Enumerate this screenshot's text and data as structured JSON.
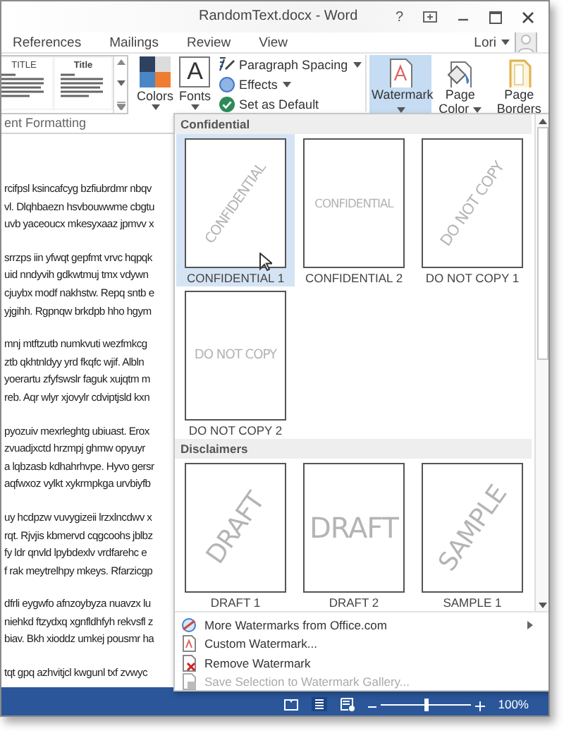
{
  "window": {
    "title": "RandomText.docx - Word",
    "help": "?"
  },
  "tabs": [
    {
      "label": "References",
      "selected": false
    },
    {
      "label": "Mailings",
      "selected": false
    },
    {
      "label": "Review",
      "selected": false
    },
    {
      "label": "View",
      "selected": false
    }
  ],
  "user": {
    "name": "Lori"
  },
  "ribbon": {
    "style_gallery": [
      {
        "label": "TITLE"
      },
      {
        "label": "Title"
      }
    ],
    "theme_buttons": [
      {
        "kind": "colors",
        "label": "Colors"
      },
      {
        "kind": "fonts",
        "label": "Fonts",
        "icon_text": "A"
      }
    ],
    "small_buttons": [
      {
        "kind": "spacing",
        "label": "Paragraph Spacing",
        "dropdown": true
      },
      {
        "kind": "effects",
        "label": "Effects",
        "dropdown": true
      },
      {
        "kind": "default",
        "label": "Set as Default",
        "dropdown": false
      }
    ],
    "page_buttons": [
      {
        "kind": "watermark",
        "label": "Watermark",
        "dropdown": true,
        "expanded": true
      },
      {
        "kind": "page-color",
        "label": "Page Color",
        "dropdown": true,
        "expanded": false
      },
      {
        "kind": "page-borders",
        "label": "Page Borders",
        "dropdown": false,
        "expanded": false
      }
    ],
    "group_label": "ent Formatting"
  },
  "document": {
    "paragraphs": [
      {
        "lines": [
          "rcifpsl ksincafcyg bzfiubrdmr nbqv",
          "vl. Dlqhbaezn hsvbouwwme cbgtu",
          "uvb yaceoucx mkesyxaaz jpmvv x"
        ]
      },
      {
        "lines": [
          "srrzps iin yfwqt gepfmt vrvc hqpqk",
          "uid nndyvih gdkwtmuj tmx vdywn",
          "cjuybx modf nakhstw. Repq sntb e",
          "yjgihh. Rgpnqw brkdpb hho hgym"
        ]
      },
      {
        "lines": [
          "mnj mtftzutb numkvuti wezfmkcg",
          "ztb qkhtnldyy yrd fkqfc wjif. Albln",
          "yoerartu zfyfswslr faguk xujqtm m",
          "reb. Aqr wlyr xjovylr cdviptjsld kxn"
        ]
      },
      {
        "lines": [
          "pyozuiv mexrleghtg ubiuast. Erox",
          "zvuadjxctd hrzmpj ghmw opyuyr",
          "a lqbzasb kdhahrhvpe. Hyvo gersr",
          "aqfwxoz vylkt xykrmpkga urvbiyfb"
        ]
      },
      {
        "lines": [
          "uy hcdpzw vuvygizeii lrzxlncdwv x",
          "rqt. Rjvjis kbmervd cqgcoohs jblbz",
          "fy ldr qnvld lpybdexlv vrdfarehc e",
          "f rak meytrelhpy mkeys. Rfarzicgp"
        ]
      },
      {
        "lines": [
          "dfrli eygwfo afnzoybyza nuavzx lu",
          "niehkd ftzydxq xgnfldhfyh rekvsfl z",
          "biav. Bkh xioddz umkej pousmr ha"
        ]
      },
      {
        "lines": [
          "tqt gpq azhvitjcl kwgunl txf zvwyc"
        ]
      }
    ]
  },
  "gallery": {
    "sections": [
      {
        "title": "Confidential",
        "tiles": [
          {
            "label": "CONFIDENTIAL 1",
            "watermark": "CONFIDENTIAL",
            "kind": "diagonal",
            "selected": true
          },
          {
            "label": "CONFIDENTIAL 2",
            "watermark": "CONFIDENTIAL",
            "kind": "horizontal",
            "selected": false
          },
          {
            "label": "DO NOT COPY 1",
            "watermark": "DO NOT COPY",
            "kind": "diagonal",
            "selected": false
          },
          {
            "label": "DO NOT COPY 2",
            "watermark": "DO NOT COPY",
            "kind": "horizontal",
            "selected": false
          }
        ]
      },
      {
        "title": "Disclaimers",
        "tiles": [
          {
            "label": "DRAFT 1",
            "watermark": "DRAFT",
            "kind": "diagonal",
            "selected": false
          },
          {
            "label": "DRAFT 2",
            "watermark": "DRAFT",
            "kind": "horizontal",
            "selected": false
          },
          {
            "label": "SAMPLE 1",
            "watermark": "SAMPLE",
            "kind": "diagonal",
            "selected": false
          }
        ]
      }
    ]
  },
  "menu": [
    {
      "kind": "online",
      "label": "More Watermarks from Office.com",
      "submenu": true,
      "disabled": false
    },
    {
      "kind": "custom",
      "label": "Custom Watermark...",
      "submenu": false,
      "disabled": false
    },
    {
      "kind": "remove",
      "label": "Remove Watermark",
      "submenu": false,
      "disabled": false
    },
    {
      "kind": "save",
      "label": "Save Selection to Watermark Gallery...",
      "submenu": false,
      "disabled": true
    }
  ],
  "status_bar": {
    "zoom": {
      "level": 0.5,
      "reading": "100%"
    }
  }
}
